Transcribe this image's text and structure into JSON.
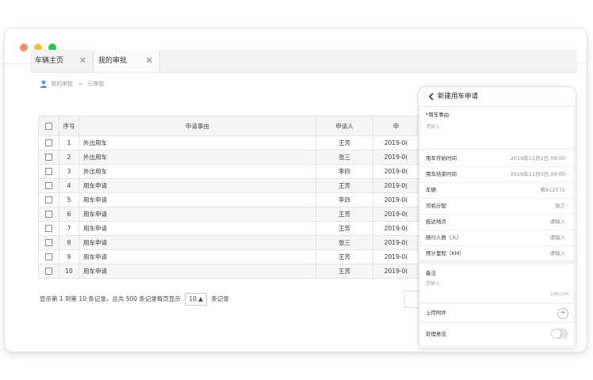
{
  "tabs": [
    {
      "label": "车辆主页"
    },
    {
      "label": "我的审批"
    }
  ],
  "breadcrumb": {
    "items": [
      "我的审批",
      "已审批"
    ],
    "separator": ">"
  },
  "table": {
    "headers": {
      "seq": "序号",
      "reason": "申请事由",
      "applicant": "申请人",
      "time": "申"
    },
    "rows": [
      {
        "seq": "1",
        "reason": "外出用车",
        "applicant": "王芳",
        "time": "2019-0("
      },
      {
        "seq": "2",
        "reason": "外出用车",
        "applicant": "张三",
        "time": "2019-0("
      },
      {
        "seq": "3",
        "reason": "外出用车",
        "applicant": "李四",
        "time": "2019-0("
      },
      {
        "seq": "4",
        "reason": "用车申请",
        "applicant": "王芳",
        "time": "2019-0("
      },
      {
        "seq": "5",
        "reason": "用车申请",
        "applicant": "李四",
        "time": "2019-0("
      },
      {
        "seq": "6",
        "reason": "用车申请",
        "applicant": "王芳",
        "time": "2019-0("
      },
      {
        "seq": "7",
        "reason": "用车申请",
        "applicant": "王芳",
        "time": "2019-0("
      },
      {
        "seq": "8",
        "reason": "用车申请",
        "applicant": "张三",
        "time": "2019-0("
      },
      {
        "seq": "9",
        "reason": "用车申请",
        "applicant": "王芳",
        "time": "2019-0("
      },
      {
        "seq": "10",
        "reason": "用车申请",
        "applicant": "王芳",
        "time": "2019-0("
      }
    ]
  },
  "pager": {
    "info": "显示第 1 到第 10 条记录，总共 500 条记录每页显示",
    "page_size": "10 ▲",
    "suffix": "条记录"
  },
  "panel": {
    "title": "新建用车申请",
    "reason_label": "*用车事由",
    "reason_placeholder": "请输入",
    "start_label": "用车开始时间",
    "start_value": "2019年11月2日 09:00",
    "end_label": "用车结束时间",
    "end_value": "2019年11月3日 09:00",
    "vehicle_label": "车辆",
    "vehicle_value": "粤A12572",
    "driver_label": "司机分配",
    "driver_value": "张三",
    "destination_label": "抵达地点",
    "destination_placeholder": "请输入",
    "passengers_label": "随行人数（人）",
    "passengers_placeholder": "请输入",
    "mileage_label": "预计里程（KM）",
    "mileage_placeholder": "请输入",
    "remark_label": "备注",
    "remark_placeholder": "请输入",
    "remark_counter": "140/140",
    "attachment_label": "上传附件",
    "opinion_label": "处理意见"
  },
  "colors": {
    "close": "#f28b66",
    "minimize": "#f5c03e",
    "maximize": "#2ec24f",
    "breadcrumb_icon": "#4a90d9"
  }
}
